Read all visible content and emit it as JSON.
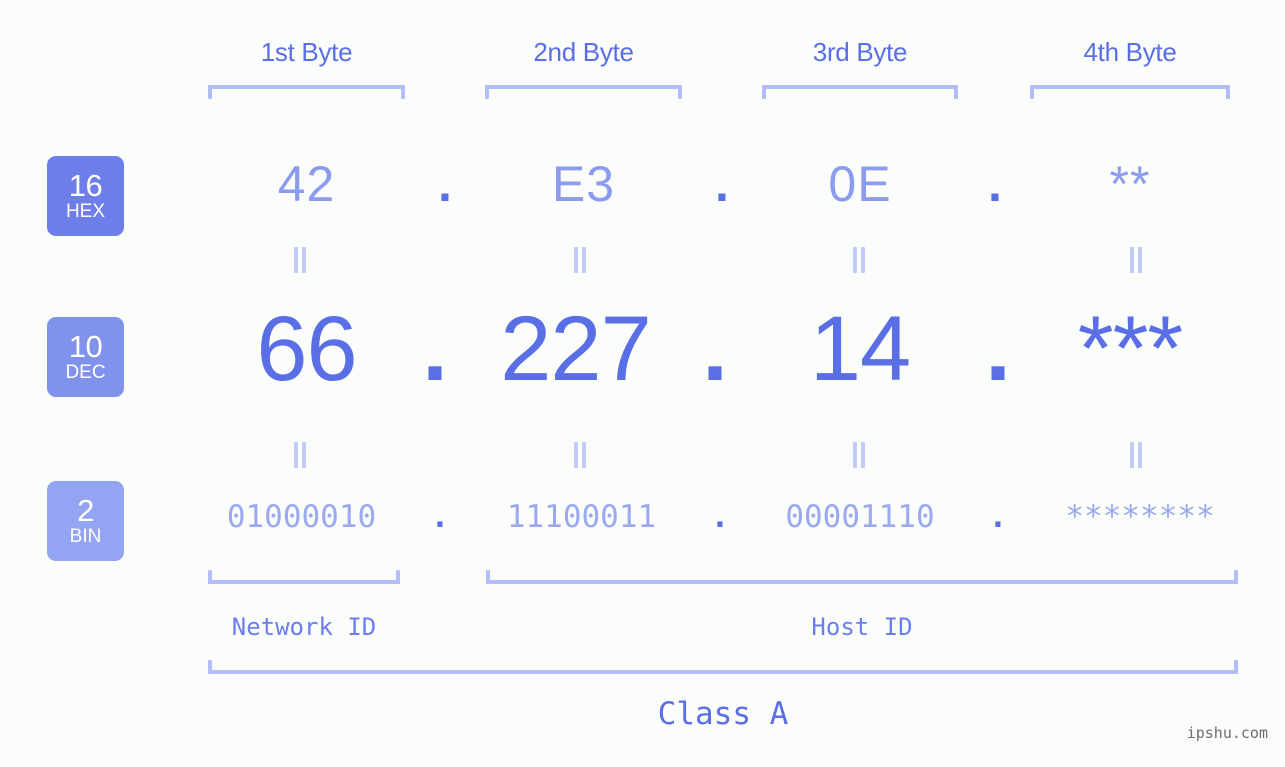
{
  "meta": {
    "background_color": "#fbfdfa",
    "accent_strong": "#5a6ee6",
    "accent_mid": "#8b9bee",
    "accent_light": "#b3bdf7",
    "watermark": "ipshu.com"
  },
  "headers": [
    {
      "label": "1st Byte"
    },
    {
      "label": "2nd Byte"
    },
    {
      "label": "3rd Byte"
    },
    {
      "label": "4th Byte"
    }
  ],
  "bases": [
    {
      "number": "16",
      "name": "HEX",
      "color": "#6d7ee8"
    },
    {
      "number": "10",
      "name": "DEC",
      "color": "#8092ec"
    },
    {
      "number": "2",
      "name": "BIN",
      "color": "#93a4f2"
    }
  ],
  "rows": {
    "hex": {
      "values": [
        "42",
        "E3",
        "0E",
        "**"
      ],
      "separator": "."
    },
    "dec": {
      "values": [
        "66",
        "227",
        "14",
        "***"
      ],
      "separator": "."
    },
    "bin": {
      "values": [
        "01000010",
        "11100011",
        "00001110",
        "********"
      ],
      "separator": "."
    }
  },
  "equality_glyph": "‖",
  "segments": {
    "network": {
      "label": "Network ID"
    },
    "host": {
      "label": "Host ID"
    },
    "class": {
      "label": "Class A"
    }
  }
}
